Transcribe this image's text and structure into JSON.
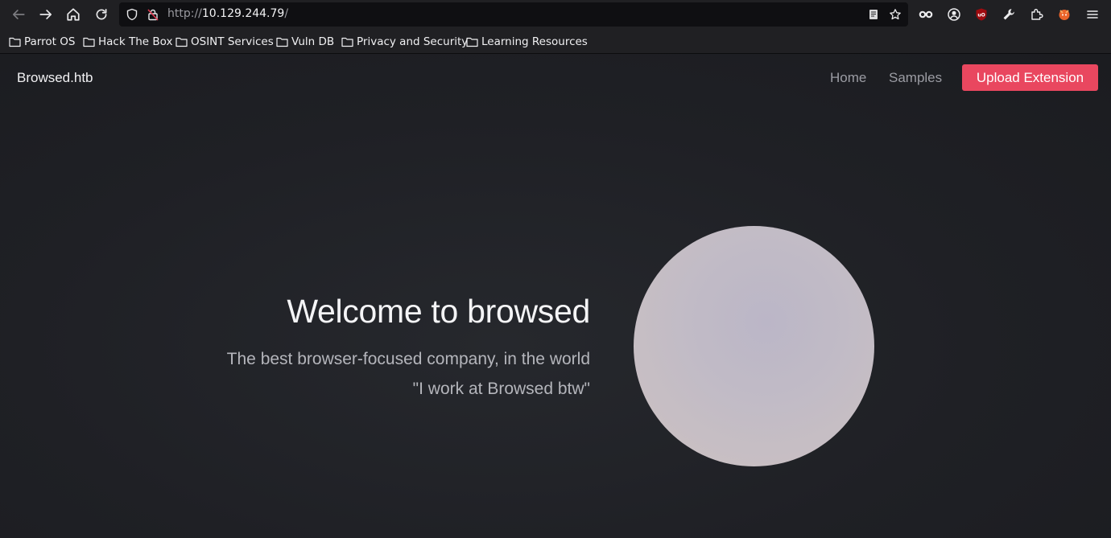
{
  "browser": {
    "url_scheme": "http://",
    "url_host": "10.129.244.79",
    "url_path": "/",
    "bookmarks": [
      {
        "label": "Parrot OS"
      },
      {
        "label": "Hack The Box"
      },
      {
        "label": "OSINT Services"
      },
      {
        "label": "Vuln DB"
      },
      {
        "label": "Privacy and Security"
      },
      {
        "label": "Learning Resources"
      }
    ]
  },
  "site": {
    "brand": "Browsed.htb",
    "nav": {
      "home": "Home",
      "samples": "Samples",
      "upload": "Upload Extension"
    },
    "hero": {
      "title": "Welcome to browsed",
      "subtitle": "The best browser-focused company, in the world",
      "quote": "\"I work at Browsed btw\""
    }
  },
  "colors": {
    "accent": "#e9475f",
    "background": "#1e1f24"
  }
}
